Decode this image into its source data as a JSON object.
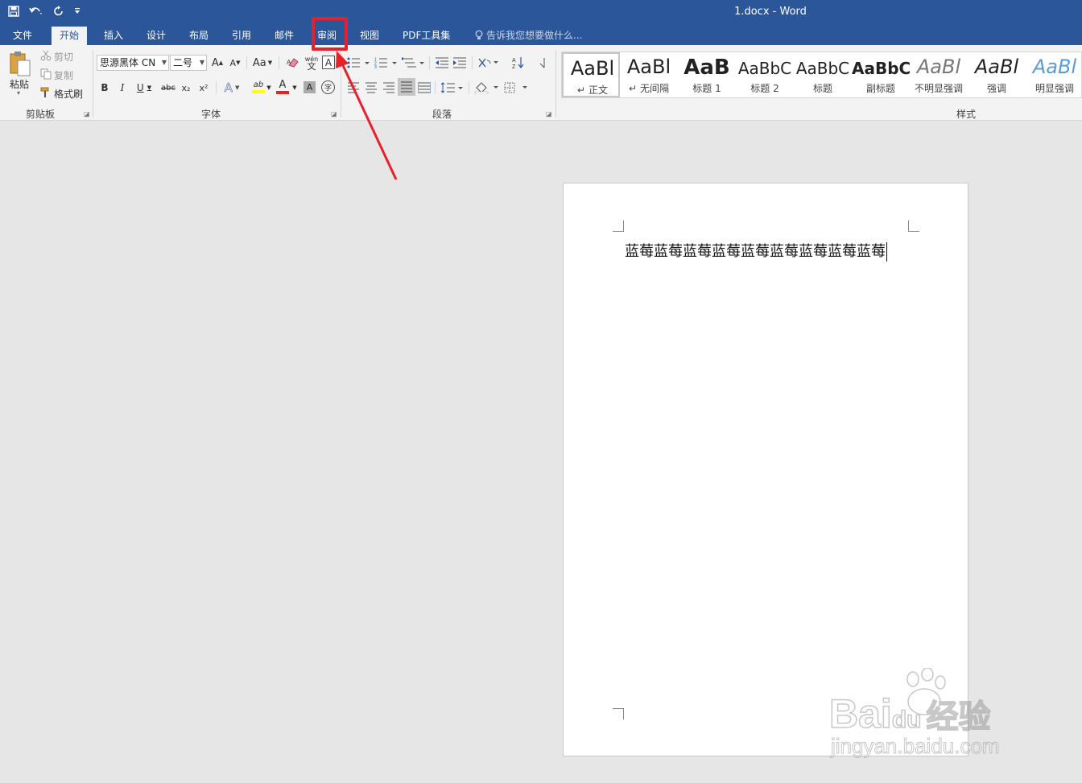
{
  "window": {
    "title": "1.docx - Word"
  },
  "qat": {
    "save_icon": "save-icon",
    "undo_icon": "undo-icon",
    "redo_icon": "redo-icon",
    "customize_icon": "customize-icon"
  },
  "tabs": [
    {
      "label": "文件",
      "id": "file"
    },
    {
      "label": "开始",
      "id": "home",
      "active": true
    },
    {
      "label": "插入",
      "id": "insert"
    },
    {
      "label": "设计",
      "id": "design"
    },
    {
      "label": "布局",
      "id": "layout"
    },
    {
      "label": "引用",
      "id": "references"
    },
    {
      "label": "邮件",
      "id": "mailings"
    },
    {
      "label": "审阅",
      "id": "review",
      "highlighted": true
    },
    {
      "label": "视图",
      "id": "view"
    },
    {
      "label": "PDF工具集",
      "id": "pdf"
    }
  ],
  "tell_me": {
    "placeholder": "告诉我您想要做什么..."
  },
  "clipboard": {
    "label": "剪贴板",
    "paste": "粘贴",
    "cut": "剪切",
    "copy": "复制",
    "format_painter": "格式刷"
  },
  "font": {
    "label": "字体",
    "font_name": "思源黑体 CN",
    "font_size": "二号",
    "bold": "B",
    "italic": "I",
    "underline": "U",
    "strikethrough": "abc",
    "subscript": "x₂",
    "superscript": "x²",
    "change_case": "Aa",
    "grow": "A",
    "shrink": "A",
    "phonetic": "wén",
    "phonetic_char": "文",
    "border_char": "A",
    "enclose_char": "字",
    "font_color_char": "A",
    "highlight_char": "ab",
    "effects_char": "A",
    "shading_char": "A",
    "colors": {
      "highlight": "#ffff00",
      "font_color": "#e8202a"
    }
  },
  "paragraph": {
    "label": "段落"
  },
  "styles": {
    "label": "样式",
    "items": [
      {
        "sample": "AaBl",
        "name": "正文",
        "mark": "↵"
      },
      {
        "sample": "AaBl",
        "name": "无间隔",
        "mark": "↵"
      },
      {
        "sample": "AaB",
        "name": "标题 1"
      },
      {
        "sample": "AaBbC",
        "name": "标题 2"
      },
      {
        "sample": "AaBbC",
        "name": "标题"
      },
      {
        "sample": "AaBbC",
        "name": "副标题"
      },
      {
        "sample": "AaBl",
        "name": "不明显强调"
      },
      {
        "sample": "AaBl",
        "name": "强调"
      },
      {
        "sample": "AaBl",
        "name": "明显强调"
      }
    ]
  },
  "document": {
    "text": "蓝莓蓝莓蓝莓蓝莓蓝莓蓝莓蓝莓蓝莓蓝莓"
  },
  "watermark": {
    "main": "Bai",
    "main2": "du",
    "main3": "经验",
    "sub": "jingyan.baidu.com"
  },
  "colors": {
    "accent": "#2b579a",
    "annotation": "#e8202a"
  }
}
